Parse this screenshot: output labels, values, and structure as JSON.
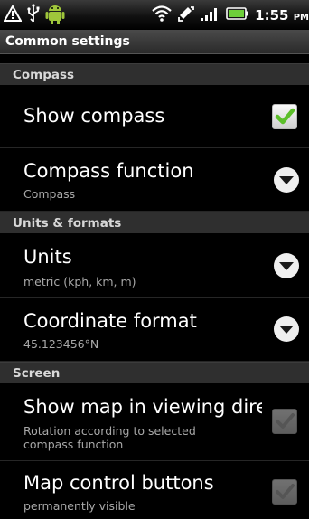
{
  "status_bar": {
    "left_icons": [
      "warning-icon",
      "usb-icon",
      "android-icon"
    ],
    "right_icons": [
      "wifi-icon",
      "sync-icon",
      "signal-icon",
      "battery-icon"
    ],
    "time": "1:55",
    "ampm": "PM"
  },
  "title": "Common settings",
  "sections": [
    {
      "header": "Compass"
    },
    {
      "header": "Units & formats"
    },
    {
      "header": "Screen"
    }
  ],
  "settings": {
    "show_compass": {
      "title": "Show compass",
      "checked": true
    },
    "compass_function": {
      "title": "Compass function",
      "summary": "Compass"
    },
    "units": {
      "title": "Units",
      "summary": "metric (kph, km, m)"
    },
    "coordinate_format": {
      "title": "Coordinate format",
      "summary": "45.123456°N"
    },
    "show_map_viewing_direction": {
      "title": "Show map in viewing direction",
      "summary": "Rotation according to selected compass function",
      "checked": false,
      "enabled": false
    },
    "map_control_buttons": {
      "title": "Map control buttons",
      "summary": "permanently visible",
      "checked": false,
      "enabled": false
    }
  },
  "colors": {
    "check_green": "#5cbf2a",
    "section_bg": "#2f2f2f",
    "background": "#000000"
  }
}
